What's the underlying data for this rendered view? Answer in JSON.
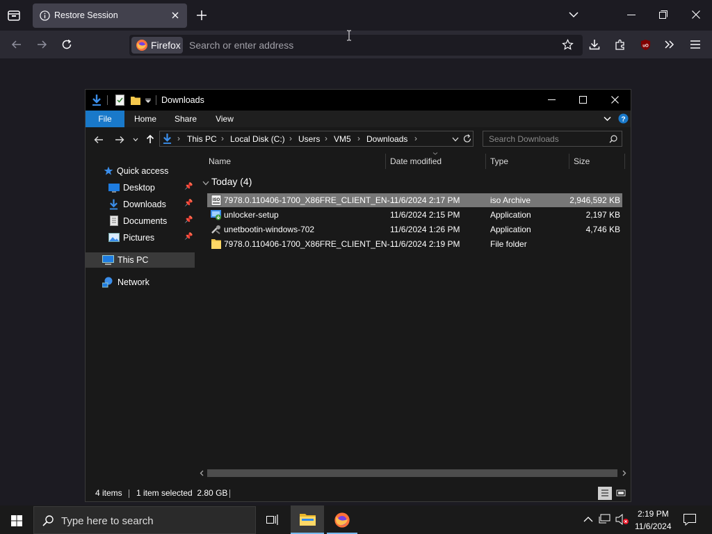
{
  "browser": {
    "tab_title": "Restore Session",
    "identity_label": "Firefox",
    "url_placeholder": "Search or enter address"
  },
  "explorer": {
    "window_title": "Downloads",
    "ribbon_tabs": [
      "File",
      "Home",
      "Share",
      "View"
    ],
    "breadcrumbs": [
      "This PC",
      "Local Disk (C:)",
      "Users",
      "VM5",
      "Downloads"
    ],
    "search_placeholder": "Search Downloads",
    "nav": {
      "quick_access": "Quick access",
      "desktop": "Desktop",
      "downloads": "Downloads",
      "documents": "Documents",
      "pictures": "Pictures",
      "this_pc": "This PC",
      "network": "Network"
    },
    "columns": [
      "Name",
      "Date modified",
      "Type",
      "Size"
    ],
    "group_header": "Today (4)",
    "files": [
      {
        "name": "7978.0.110406-1700_X86FRE_CLIENT_EN-...",
        "date": "11/6/2024 2:17 PM",
        "type": "iso Archive",
        "size": "2,946,592 KB",
        "icon": "iso-icon"
      },
      {
        "name": "unlocker-setup",
        "date": "11/6/2024 2:15 PM",
        "type": "Application",
        "size": "2,197 KB",
        "icon": "installer-icon"
      },
      {
        "name": "unetbootin-windows-702",
        "date": "11/6/2024 1:26 PM",
        "type": "Application",
        "size": "4,746 KB",
        "icon": "app-icon"
      },
      {
        "name": "7978.0.110406-1700_X86FRE_CLIENT_EN-...",
        "date": "11/6/2024 2:19 PM",
        "type": "File folder",
        "size": "",
        "icon": "folder-icon"
      }
    ],
    "status": {
      "items": "4 items",
      "selected": "1 item selected  2.80 GB"
    }
  },
  "taskbar": {
    "search_placeholder": "Type here to search",
    "time": "2:19 PM",
    "date": "11/6/2024"
  },
  "colors": {
    "accent": "#1979ca",
    "selection": "#777777"
  }
}
